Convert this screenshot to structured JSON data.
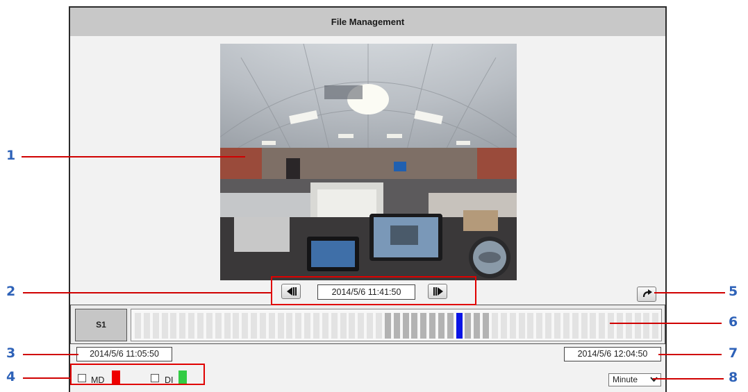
{
  "window": {
    "title": "File Management"
  },
  "player": {
    "timestamp": "2014/5/6 11:41:50",
    "prev_frame_icon": "step-backward-icon",
    "next_frame_icon": "step-forward-icon",
    "refresh_icon": "rotate-icon"
  },
  "timeline": {
    "stream_label": "S1",
    "start_time": "2014/5/6 11:05:50",
    "end_time": "2014/5/6 12:04:50",
    "segment_count": 59,
    "recorded_segments": [
      28,
      29,
      30,
      31,
      32,
      33,
      34,
      35,
      36,
      37,
      38,
      39
    ],
    "current_segment": 36,
    "colors": {
      "recorded": "#b3b3b3",
      "empty": "#e3e3e3",
      "current": "#0a14e6"
    }
  },
  "legend": {
    "md_label": "MD",
    "md_color": "#ee0000",
    "di_label": "DI",
    "di_color": "#33cc44"
  },
  "unit_select": {
    "value": "Minute"
  },
  "callouts": [
    "1",
    "2",
    "3",
    "4",
    "5",
    "6",
    "7",
    "8"
  ]
}
